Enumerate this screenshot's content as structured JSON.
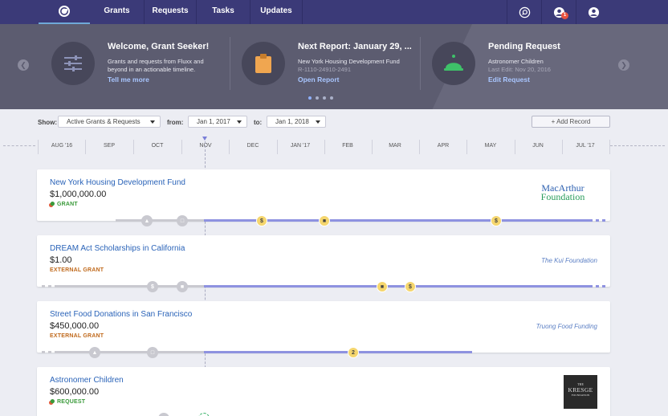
{
  "nav": {
    "links": [
      "Grants",
      "Requests",
      "Tasks",
      "Updates"
    ],
    "notification_count": "1",
    "colors": {
      "bar": "#3b3a78",
      "accent": "#6fa9d8"
    },
    "icons": [
      "logo-icon",
      "search-icon",
      "notifications-icon",
      "profile-icon"
    ]
  },
  "hero": {
    "panels": [
      {
        "title": "Welcome, Grant Seeker!",
        "line1": "Grants and requests from Fluxx and",
        "line2": "beyond in an actionable timeline.",
        "link": "Tell me more",
        "icon": "sliders-icon"
      },
      {
        "title": "Next Report: January 29, ...",
        "line1": "New York Housing Development Fund",
        "muted": "R-1110-24910-2491",
        "link": "Open Report",
        "icon": "clipboard-icon"
      },
      {
        "title": "Pending Request",
        "line1": "Astronomer Children",
        "muted": "Last Edit: Nov 20, 2016",
        "link": "Edit Request",
        "icon": "bell-icon"
      }
    ],
    "page_dots": 4,
    "active_dot": 1
  },
  "filters": {
    "show_label": "Show:",
    "show_value": "Active Grants & Requests",
    "from_label": "from:",
    "from_value": "Jan 1, 2017",
    "to_label": "to:",
    "to_value": "Jan 1, 2018",
    "add_button": "+ Add Record"
  },
  "timeline": {
    "months": [
      "AUG '16",
      "SEP",
      "OCT",
      "NOV",
      "DEC",
      "JAN '17",
      "FEB",
      "MAR",
      "APR",
      "MAY",
      "JUN",
      "JUL '17"
    ]
  },
  "records": [
    {
      "title": "New York Housing Development Fund",
      "amount": "$1,000,000.00",
      "type": "GRANT",
      "funder_logo": "macarthur",
      "logo_line1": "MacArthur",
      "logo_line2": "Foundation"
    },
    {
      "title": "DREAM Act Scholarships in California",
      "amount": "$1.00",
      "type": "EXTERNAL GRANT",
      "funder": "The Kui Foundation"
    },
    {
      "title": "Street Food Donations in San Francisco",
      "amount": "$450,000.00",
      "type": "EXTERNAL GRANT",
      "funder": "Truong Food Funding",
      "node_count": "2"
    },
    {
      "title": "Astronomer Children",
      "amount": "$600,000.00",
      "type": "REQUEST",
      "funder_logo": "kresge",
      "logo_small": "THE",
      "logo_main": "KRESGE",
      "logo_sub": "FOUNDATION"
    }
  ]
}
